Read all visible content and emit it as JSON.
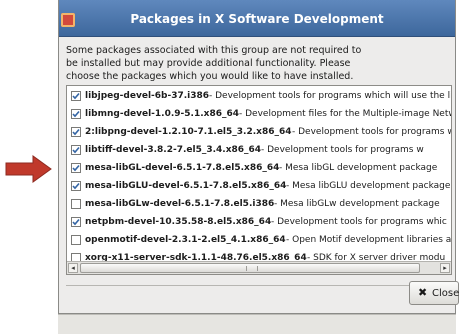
{
  "dialog": {
    "title": "Packages in X Software Development",
    "description": [
      "Some packages associated with this group are not required to",
      "be installed but may provide additional functionality.  Please",
      "choose the packages which you would like to have installed."
    ],
    "packages": [
      {
        "name": "libjpeg-devel-6b-37.i386",
        "description": " - Development tools for programs which will use the li",
        "checked": true
      },
      {
        "name": "libmng-devel-1.0.9-5.1.x86_64",
        "description": " - Development files for the Multiple-image Netw",
        "checked": true
      },
      {
        "name": "2:libpng-devel-1.2.10-7.1.el5_3.2.x86_64",
        "description": " - Development tools for programs w",
        "checked": true
      },
      {
        "name": "libtiff-devel-3.8.2-7.el5_3.4.x86_64",
        "description": " - Development tools for programs w",
        "checked": true
      },
      {
        "name": "mesa-libGL-devel-6.5.1-7.8.el5.x86_64",
        "description": " - Mesa libGL development package",
        "checked": true
      },
      {
        "name": "mesa-libGLU-devel-6.5.1-7.8.el5.x86_64",
        "description": " - Mesa libGLU development package",
        "checked": true
      },
      {
        "name": "mesa-libGLw-devel-6.5.1-7.8.el5.i386",
        "description": " - Mesa libGLw development package",
        "checked": false
      },
      {
        "name": "netpbm-devel-10.35.58-8.el5.x86_64",
        "description": " - Development tools for programs whic",
        "checked": true
      },
      {
        "name": "openmotif-devel-2.3.1-2.el5_4.1.x86_64",
        "description": " - Open Motif development libraries a",
        "checked": false
      },
      {
        "name": "xorg-x11-server-sdk-1.1.1-48.76.el5.x86_64",
        "description": " - SDK for X server driver modu",
        "checked": false
      }
    ],
    "scroll_left": "◂",
    "scroll_right": "▸",
    "close_icon": "✖",
    "close_label": "Close"
  },
  "colors": {
    "titlebar": "#4a74aa",
    "arrow": "#c0392b",
    "check": "#3465a4"
  }
}
